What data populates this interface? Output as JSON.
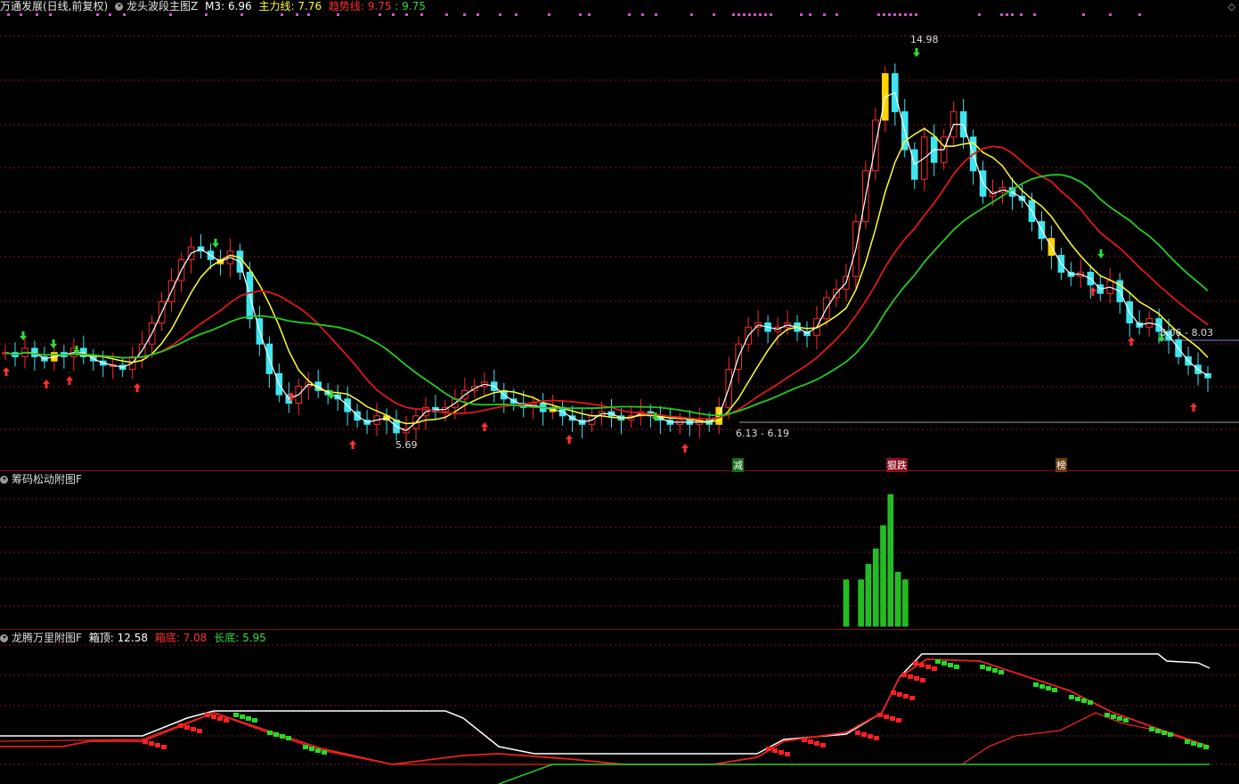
{
  "header": {
    "title": "万通发展(日线,前复权)",
    "indicator_name": "龙头波段主图Z",
    "m3_label": "M3:",
    "m3_value": "6.96",
    "main_label": "主力线:",
    "main_value": "7.76",
    "trend_label": "趋势线:",
    "trend_value": "9.75",
    "trend_value2": ": 9.75"
  },
  "panel2": {
    "title": "筹码松动附图F"
  },
  "panel3": {
    "title": "龙腾万里附图F",
    "box_top_label": "箱顶:",
    "box_top_value": "12.58",
    "box_bottom_label": "箱底:",
    "box_bottom_value": "7.08",
    "long_bottom_label": "长底:",
    "long_bottom_value": "5.95"
  },
  "annotations": {
    "high": "14.98",
    "low": "5.69",
    "range1": "6.13 - 6.19",
    "range2": "8.06 - 8.03",
    "label_reduce": "减",
    "label_drop": "狠跌",
    "label_buy": "榜"
  },
  "colors": {
    "up": "#ff2a2a",
    "down": "#3ee6f0",
    "signal": "#ffd400",
    "ma_white": "#ffffff",
    "ma_yellow": "#ffff33",
    "ma_red": "#e01818",
    "ma_green": "#22cc22",
    "grid": "#7a1a1a"
  },
  "chart_data": [
    {
      "type": "candlestick",
      "title": "龙头波段主图Z",
      "annotated_high": 14.98,
      "annotated_low": 5.69,
      "ranges": [
        [
          6.13,
          6.19
        ],
        [
          8.06,
          8.03
        ]
      ],
      "series": [
        {
          "name": "M3",
          "last": 6.96
        },
        {
          "name": "主力线",
          "last": 7.76
        },
        {
          "name": "趋势线",
          "last": 9.75
        }
      ],
      "close": [
        7.7,
        7.6,
        7.8,
        7.6,
        7.5,
        7.7,
        7.6,
        7.8,
        7.6,
        7.5,
        7.4,
        7.4,
        7.3,
        7.6,
        7.9,
        8.4,
        8.9,
        9.4,
        9.9,
        10.2,
        10.1,
        9.9,
        9.8,
        10.1,
        9.6,
        8.5,
        7.9,
        7.2,
        6.7,
        6.5,
        6.9,
        7.0,
        6.8,
        6.7,
        6.6,
        6.3,
        6.1,
        6.0,
        6.2,
        6.1,
        5.8,
        5.9,
        6.2,
        6.4,
        6.3,
        6.4,
        6.6,
        6.8,
        6.9,
        7.0,
        6.8,
        6.6,
        6.5,
        6.4,
        6.5,
        6.3,
        6.4,
        6.2,
        6.1,
        6.0,
        6.2,
        6.3,
        6.2,
        6.1,
        6.2,
        6.3,
        6.2,
        6.1,
        6.0,
        6.1,
        6.0,
        6.1,
        6.0,
        6.4,
        7.3,
        7.9,
        8.3,
        8.4,
        8.2,
        8.3,
        8.4,
        8.2,
        8.1,
        8.5,
        9.0,
        9.2,
        9.5,
        10.8,
        12.0,
        13.2,
        14.3,
        13.4,
        12.5,
        11.8,
        12.8,
        12.2,
        12.8,
        13.4,
        12.8,
        12.0,
        11.4,
        11.5,
        11.6,
        11.4,
        11.3,
        10.8,
        10.4,
        10.0,
        9.6,
        9.5,
        9.6,
        9.3,
        9.1,
        9.4,
        8.9,
        8.4,
        8.3,
        8.5,
        8.2,
        8.0,
        7.6,
        7.4,
        7.2,
        7.1
      ]
    },
    {
      "type": "bar",
      "title": "筹码松动附图F",
      "values": [
        0.6,
        0,
        0.6,
        0.8,
        1.0,
        1.3,
        1.7,
        0.7,
        0.6
      ]
    },
    {
      "type": "line",
      "title": "龙腾万里附图F",
      "series": [
        {
          "name": "箱顶",
          "last": 12.58
        },
        {
          "name": "箱底",
          "last": 7.08
        },
        {
          "name": "长底",
          "last": 5.95
        }
      ]
    }
  ]
}
